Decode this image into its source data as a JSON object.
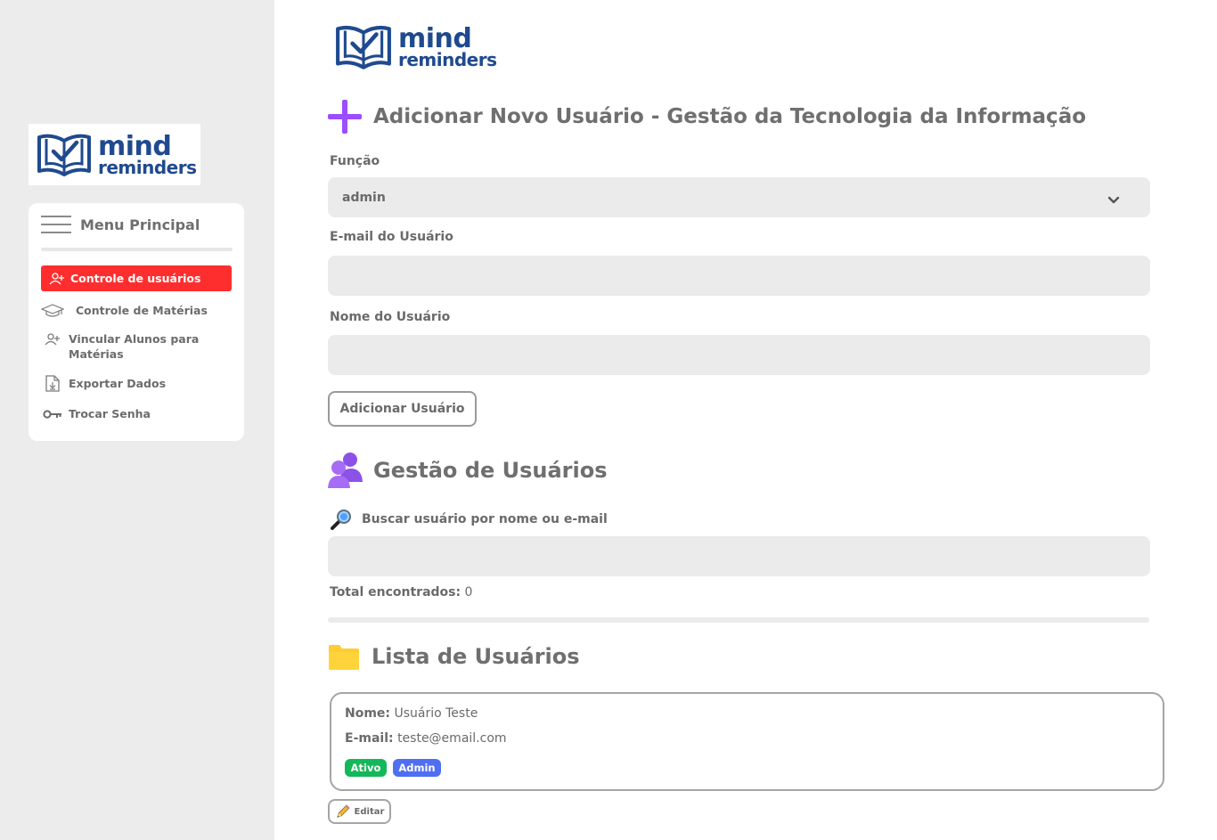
{
  "brand": {
    "logo_line1": "mind",
    "logo_line2": "reminders",
    "color": "#1f4a8f"
  },
  "sidebar": {
    "menu_title": "Menu Principal",
    "items": [
      {
        "label": "Controle de usuários",
        "icon": "user-plus-icon",
        "active": true
      },
      {
        "label": "Controle de Matérias",
        "icon": "graduation-cap-icon",
        "active": false
      },
      {
        "label_line1": "Vincular Alunos para",
        "label_line2": "Matérias",
        "icon": "user-plus-icon",
        "active": false
      },
      {
        "label": "Exportar Dados",
        "icon": "file-export-icon",
        "active": false
      },
      {
        "label": "Trocar Senha",
        "icon": "key-icon",
        "active": false
      }
    ],
    "active_color": "#ff2e2e"
  },
  "add_user": {
    "title": "Adicionar Novo Usuário - Gestão da Tecnologia da Informação",
    "icon": "plus-icon",
    "role_label": "Função",
    "role_value": "admin",
    "email_label": "E-mail do Usuário",
    "email_value": "",
    "name_label": "Nome do Usuário",
    "name_value": "",
    "submit_label": "Adicionar Usuário"
  },
  "management": {
    "title": "Gestão de Usuários",
    "icon": "users-icon",
    "search_label": "Buscar usuário por nome ou e-mail",
    "search_value": "",
    "total_label": "Total encontrados:",
    "total_value": "0"
  },
  "list": {
    "title": "Lista de Usuários",
    "icon": "folder-icon",
    "users": [
      {
        "name_label": "Nome:",
        "name": "Usuário Teste",
        "email_label": "E-mail:",
        "email": "teste@email.com",
        "status": "Ativo",
        "status_color": "#14b85a",
        "role": "Admin",
        "role_color": "#4f6ef2",
        "edit_label": "Editar"
      }
    ]
  }
}
